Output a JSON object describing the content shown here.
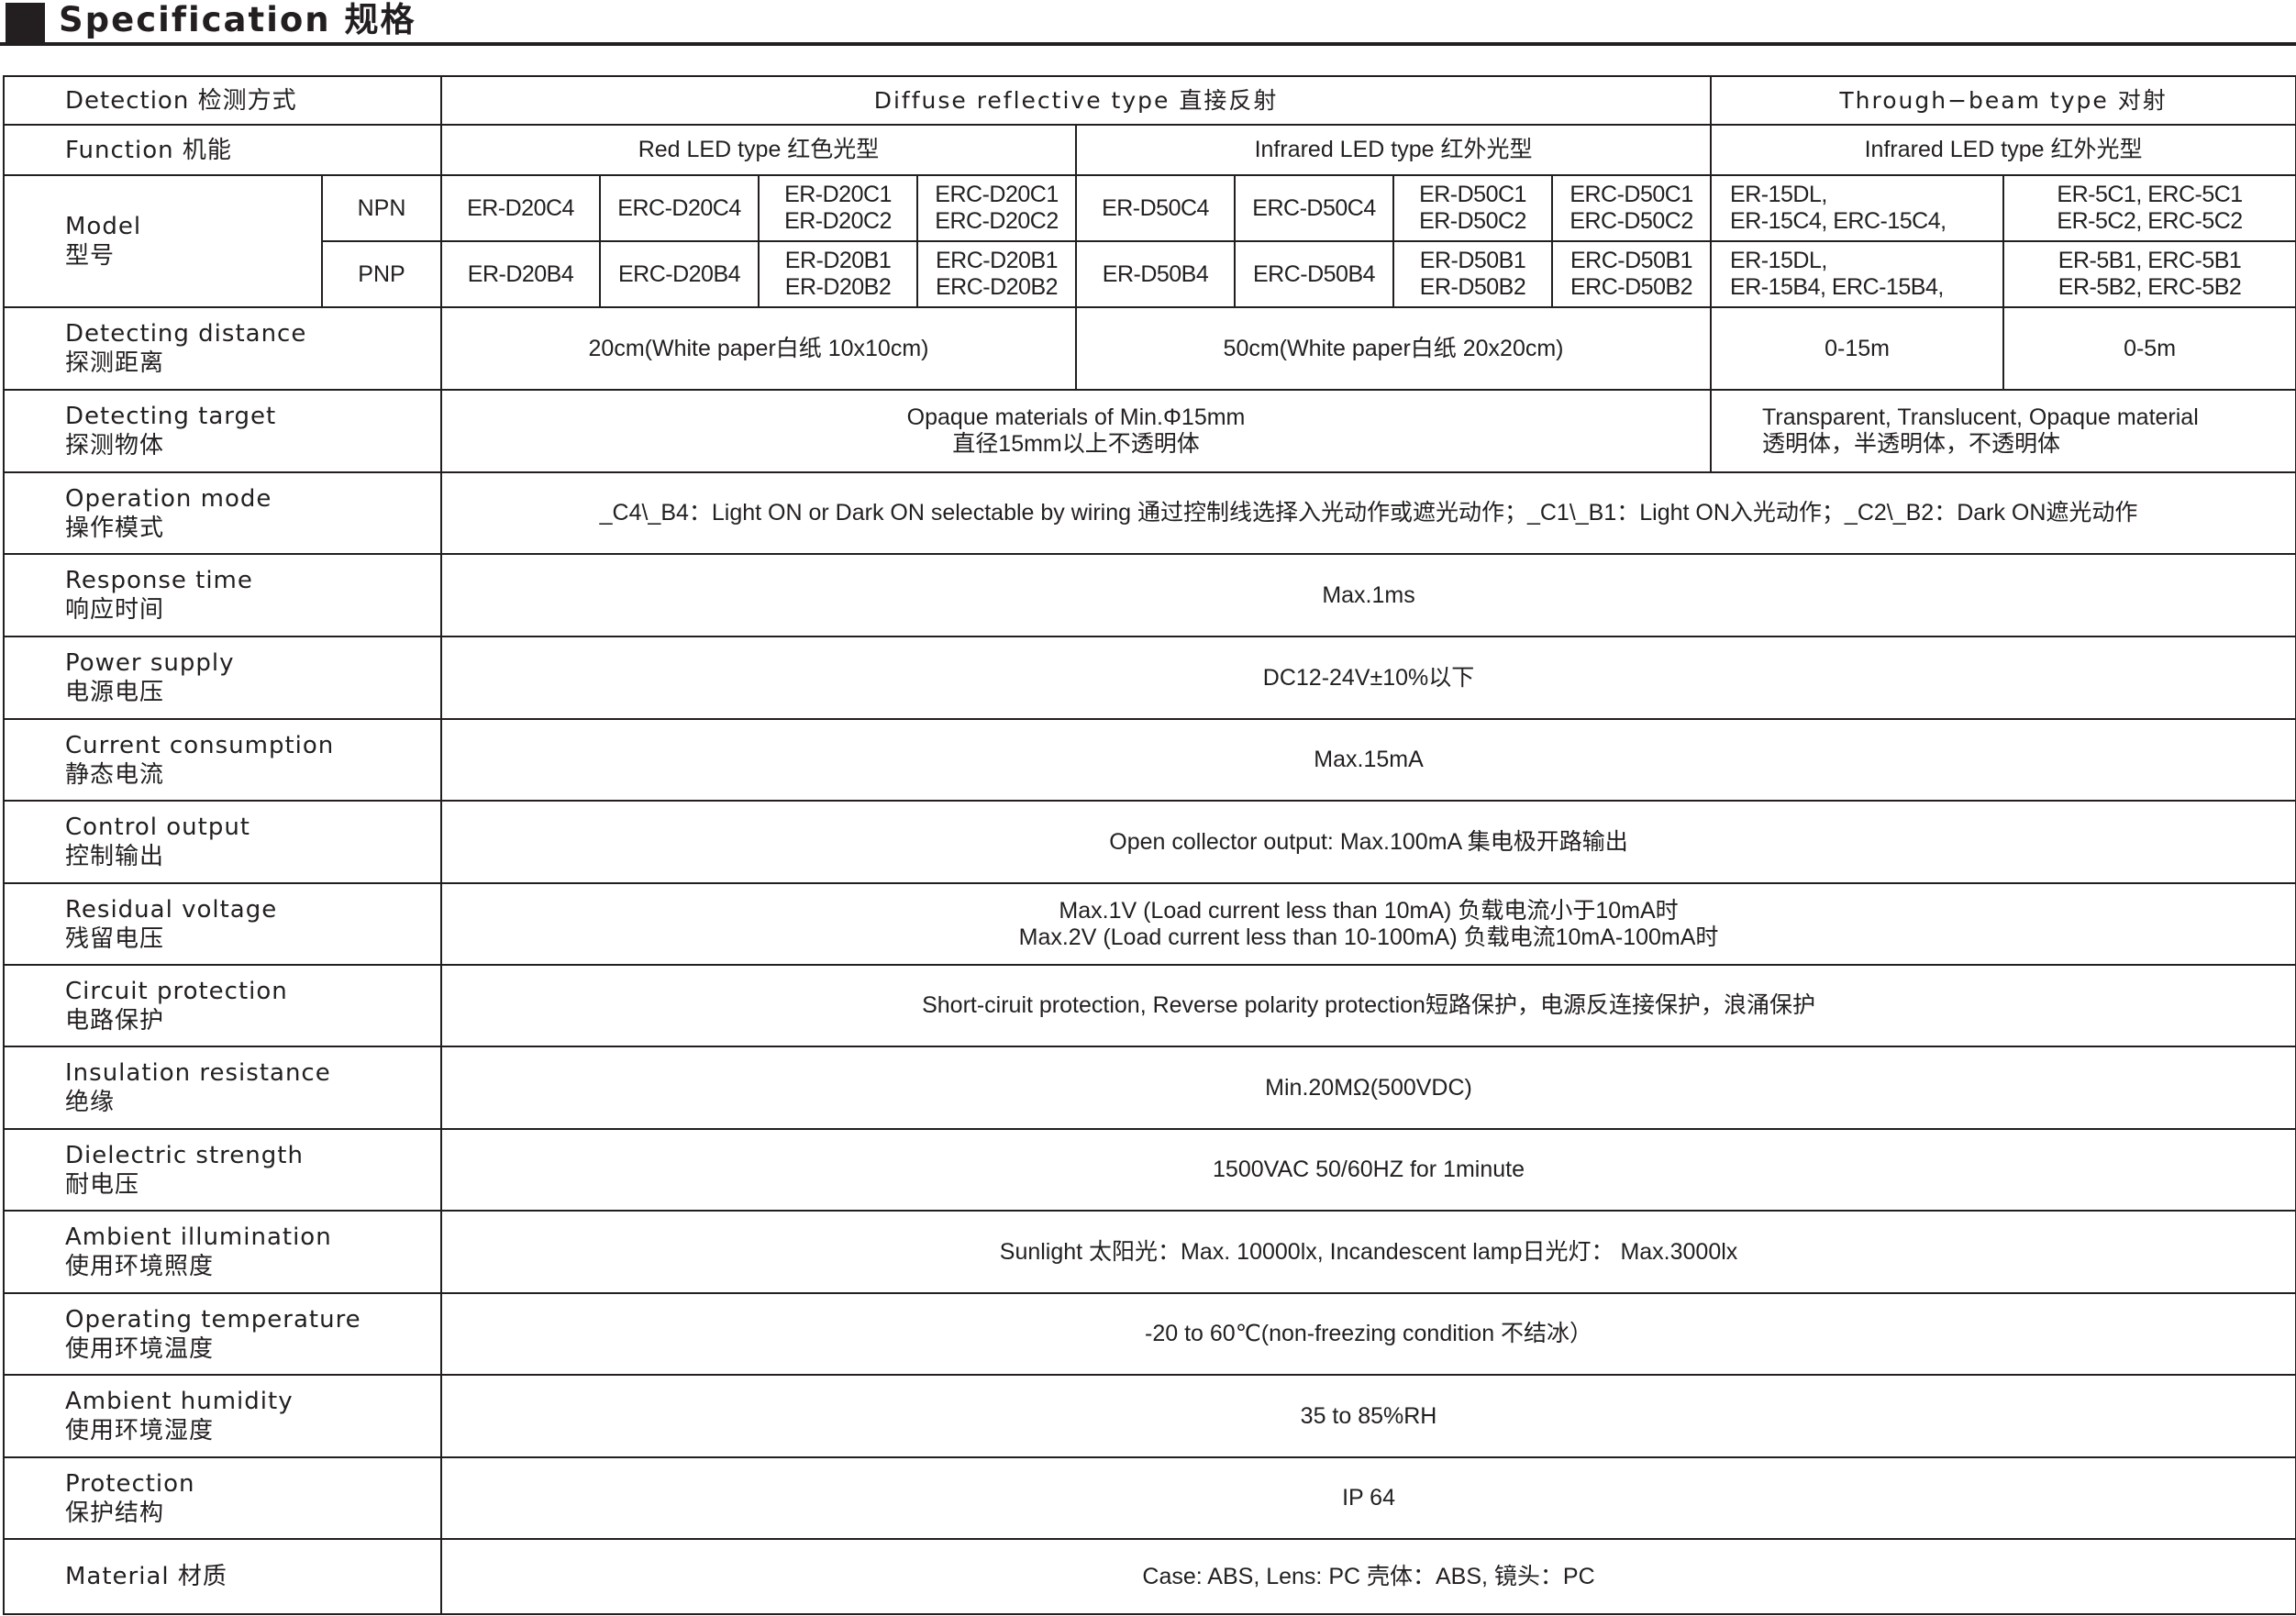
{
  "header": {
    "title": "Specification 规格"
  },
  "table": {
    "row_detection": {
      "label": "Detection 检测方式",
      "diffuse": "Diffuse reflective type  直接反射",
      "through": "Through−beam type  对射"
    },
    "row_function": {
      "label": "Function 机能",
      "red": "Red LED type 红色光型",
      "ir1": "Infrared LED type 红外光型",
      "ir2": "Infrared LED type 红外光型"
    },
    "row_model": {
      "label1": "Model",
      "label2": "型号",
      "npn": {
        "label": "NPN",
        "m1": "ER-D20C4",
        "m2": "ERC-D20C4",
        "m3a": "ER-D20C1",
        "m3b": "ER-D20C2",
        "m4a": "ERC-D20C1",
        "m4b": "ERC-D20C2",
        "m5": "ER-D50C4",
        "m6": "ERC-D50C4",
        "m7a": "ER-D50C1",
        "m7b": "ER-D50C2",
        "m8a": "ERC-D50C1",
        "m8b": "ERC-D50C2",
        "m9a": "ER-15DL,",
        "m9b": "ER-15C4, ERC-15C4,",
        "m10a": "ER-5C1, ERC-5C1",
        "m10b": "ER-5C2, ERC-5C2"
      },
      "pnp": {
        "label": "PNP",
        "m1": "ER-D20B4",
        "m2": "ERC-D20B4",
        "m3a": "ER-D20B1",
        "m3b": "ER-D20B2",
        "m4a": "ERC-D20B1",
        "m4b": "ERC-D20B2",
        "m5": "ER-D50B4",
        "m6": "ERC-D50B4",
        "m7a": "ER-D50B1",
        "m7b": "ER-D50B2",
        "m8a": "ERC-D50B1",
        "m8b": "ERC-D50B2",
        "m9a": "ER-15DL,",
        "m9b": "ER-15B4, ERC-15B4,",
        "m10a": "ER-5B1, ERC-5B1",
        "m10b": "ER-5B2, ERC-5B2"
      }
    },
    "row_distance": {
      "label1": "Detecting distance",
      "label2": "探测距离",
      "v1": "20cm(White paper白纸 10x10cm)",
      "v2": "50cm(White paper白纸 20x20cm)",
      "v3": "0-15m",
      "v4": "0-5m"
    },
    "row_target": {
      "label1": "Detecting target",
      "label2": "探测物体",
      "v1a": "Opaque materials of Min.Φ15mm",
      "v1b": "直径15mm以上不透明体",
      "v2a": "Transparent, Translucent, Opaque material",
      "v2b": "透明体，半透明体，不透明体"
    },
    "row_operation": {
      "label1": "Operation mode",
      "label2": "操作模式",
      "value": "_C4\\_B4：Light ON or Dark ON selectable by wiring  通过控制线选择入光动作或遮光动作；_C1\\_B1：Light ON入光动作；_C2\\_B2：Dark ON遮光动作"
    },
    "row_response": {
      "label1": "Response time",
      "label2": "响应时间",
      "value": "Max.1ms"
    },
    "row_power": {
      "label1": "Power supply",
      "label2": "电源电压",
      "value": "DC12-24V±10%以下"
    },
    "row_current": {
      "label1": "Current consumption",
      "label2": "静态电流",
      "value": "Max.15mA"
    },
    "row_output": {
      "label1": "Control output",
      "label2": "控制输出",
      "value": "Open collector output: Max.100mA  集电极开路输出"
    },
    "row_residual": {
      "label1": "Residual voltage",
      "label2": "残留电压",
      "v1": "Max.1V  (Load current less than 10mA)  负载电流小于10mA时",
      "v2": "Max.2V  (Load current less than 10-100mA)  负载电流10mA-100mA时"
    },
    "row_circuit": {
      "label1": "Circuit protection",
      "label2": "电路保护",
      "value": "Short-ciruit protection, Reverse polarity protection短路保护，电源反连接保护，浪涌保护"
    },
    "row_insulation": {
      "label1": "Insulation resistance",
      "label2": "绝缘",
      "value": "Min.20MΩ(500VDC)"
    },
    "row_dielectric": {
      "label1": "Dielectric strength",
      "label2": "耐电压",
      "value": "1500VAC 50/60HZ for 1minute"
    },
    "row_illumination": {
      "label1": "Ambient illumination",
      "label2": "使用环境照度",
      "value": "Sunlight 太阳光：Max. 10000lx, Incandescent  lamp日光灯：  Max.3000lx"
    },
    "row_temperature": {
      "label1": "Operating temperature",
      "label2": "使用环境温度",
      "value": "-20 to 60℃(non-freezing condition 不结冰）"
    },
    "row_humidity": {
      "label1": "Ambient humidity",
      "label2": "使用环境湿度",
      "value": "35 to 85%RH"
    },
    "row_protection": {
      "label1": "Protection",
      "label2": "保护结构",
      "value": "IP 64"
    },
    "row_material": {
      "label": "Material 材质",
      "value": "Case: ABS, Lens: PC 壳体：ABS, 镜头：PC"
    }
  }
}
